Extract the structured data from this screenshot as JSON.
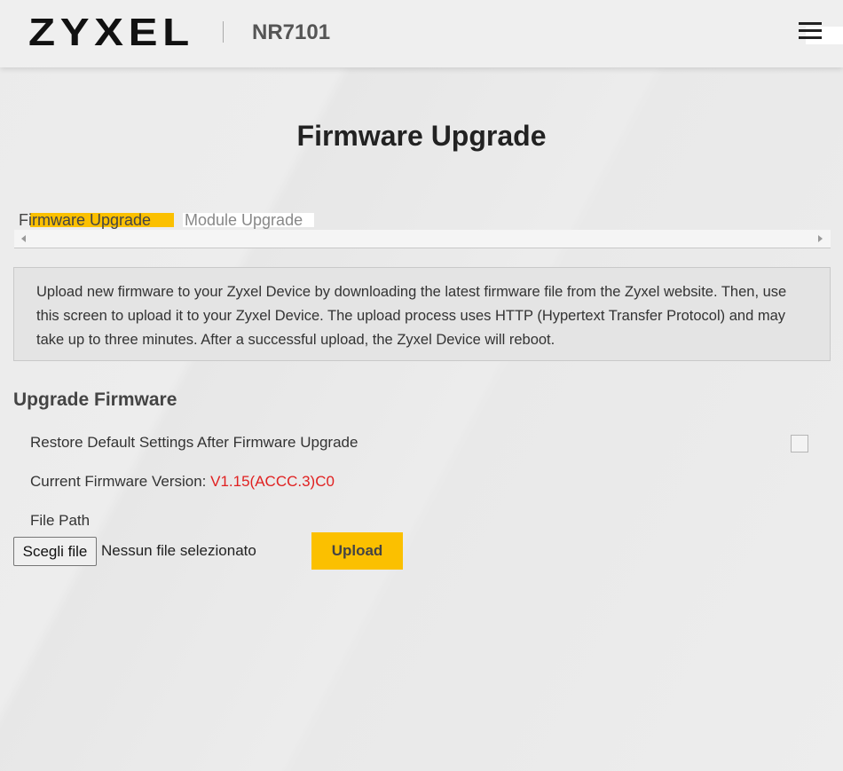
{
  "header": {
    "brand": "ZYXEL",
    "model": "NR7101",
    "menu_icon": "hamburger-icon"
  },
  "page": {
    "title": "Firmware Upgrade"
  },
  "tabs": [
    {
      "label": "Firmware Upgrade",
      "active": true
    },
    {
      "label": "Module Upgrade",
      "active": false
    }
  ],
  "info": {
    "text": "Upload new firmware to your Zyxel Device by downloading the latest firmware file from the Zyxel website. Then, use this screen to upload it to your Zyxel Device. The upload process uses HTTP (Hypertext Transfer Protocol) and may take up to three minutes. After a successful upload, the Zyxel Device will reboot."
  },
  "upgrade": {
    "section_title": "Upgrade Firmware",
    "restore_label": "Restore Default Settings After Firmware Upgrade",
    "restore_checked": false,
    "version_label": "Current Firmware Version:",
    "version_value": "V1.15(ACCC.3)C0",
    "file_path_label": "File Path",
    "choose_file_label": "Scegli file",
    "no_file_label": "Nessun file selezionato",
    "upload_label": "Upload"
  },
  "colors": {
    "accent": "#fbc000",
    "version_red": "#e02020"
  }
}
